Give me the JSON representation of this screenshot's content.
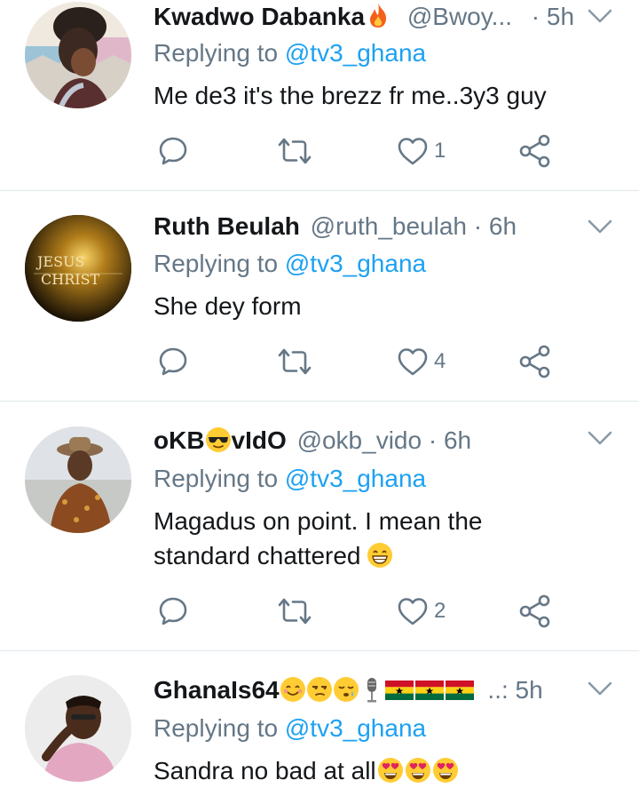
{
  "tweets": [
    {
      "display_name": "Kwadwo Dabanka",
      "handle": "@Bwoy...",
      "separator": "·",
      "time": "5h",
      "reply_prefix": "Replying to",
      "reply_to": "@tv3_ghana",
      "text": "Me de3 it's the brezz fr me..3y3 guy",
      "replies": "",
      "retweets": "",
      "likes": "1"
    },
    {
      "display_name": "Ruth Beulah",
      "handle": "@ruth_beulah",
      "separator": "·",
      "time": "6h",
      "reply_prefix": "Replying to",
      "reply_to": "@tv3_ghana",
      "text": "She dey form",
      "avatar_text_1": "JESUS",
      "avatar_text_2": "CHRIST",
      "replies": "",
      "retweets": "",
      "likes": "4"
    },
    {
      "display_name_part1": "oKB",
      "display_name_part2": "vIdO",
      "handle": "@okb_vido",
      "separator": "·",
      "time": "6h",
      "reply_prefix": "Replying to",
      "reply_to": "@tv3_ghana",
      "text_line1": "Magadus on point. I mean the",
      "text_line2": "standard chattered",
      "replies": "",
      "retweets": "",
      "likes": "2"
    },
    {
      "display_name": "GhanaIs64",
      "handle_tail": "..:",
      "time": "5h",
      "reply_prefix": "Replying to",
      "reply_to": "@tv3_ghana",
      "text": "Sandra no bad at all"
    }
  ],
  "colors": {
    "link": "#1da1f2",
    "secondary": "#657786",
    "primary": "#14171a",
    "divider": "#e1e8ed"
  },
  "icons": {
    "reply": "reply-icon",
    "retweet": "retweet-icon",
    "like": "heart-icon",
    "share": "share-icon",
    "menu": "chevron-down-icon"
  }
}
